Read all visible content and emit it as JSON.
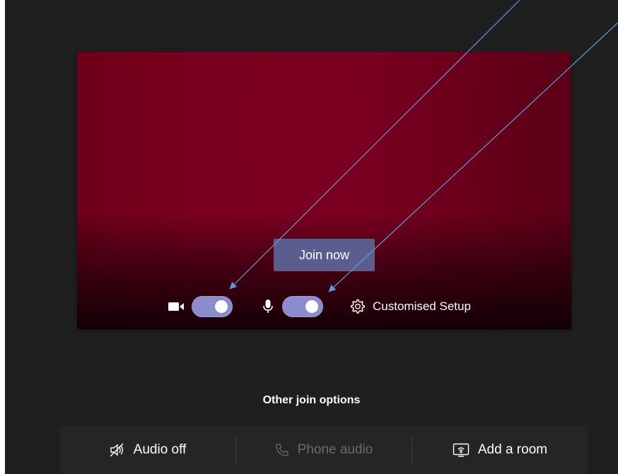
{
  "preview": {
    "join_label": "Join now"
  },
  "controls": {
    "camera": {
      "icon": "video-camera-icon",
      "state": "on"
    },
    "microphone": {
      "icon": "microphone-icon",
      "state": "on"
    },
    "setup_icon": "gear-icon",
    "setup_label": "Customised Setup"
  },
  "other_options": {
    "title": "Other join options",
    "items": [
      {
        "label": "Audio off",
        "icon": "speaker-off-icon",
        "enabled": true
      },
      {
        "label": "Phone audio",
        "icon": "phone-icon",
        "enabled": false
      },
      {
        "label": "Add a room",
        "icon": "cast-room-icon",
        "enabled": true
      }
    ]
  },
  "colors": {
    "background": "#1f1f1f",
    "preview_red": "#7a0020",
    "button": "#5b5d8f",
    "toggle_on": "#8a8ccc",
    "annotation_arrow": "#5b9bd5"
  }
}
